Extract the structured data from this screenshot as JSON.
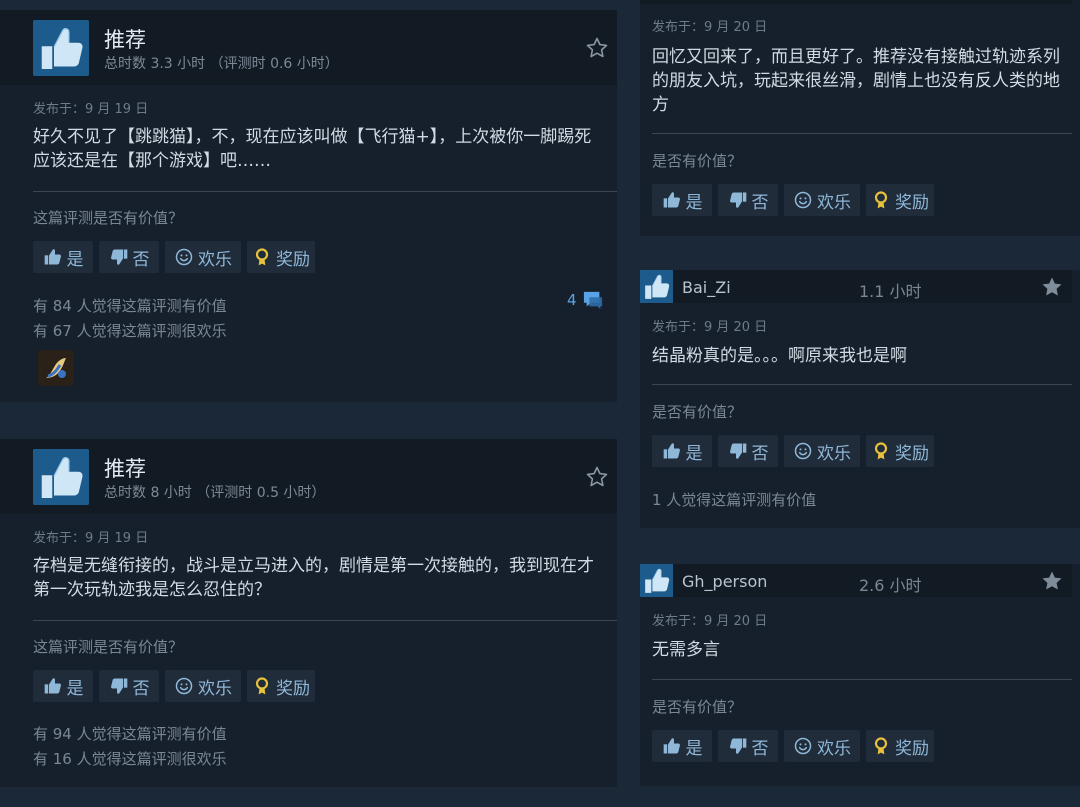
{
  "colors": {
    "background": "#1b2838",
    "panel": "#16202d",
    "header": "#121a24",
    "link": "#8fb8d8",
    "accent_blue": "#5aa3e6",
    "award_gold": "#e8c23a"
  },
  "icons": [
    "thumbs-up-icon",
    "thumbs-down-icon",
    "smile-icon",
    "award-ribbon-icon",
    "star-icon",
    "comment-icon"
  ],
  "left_reviews": [
    {
      "recommendation": "推荐",
      "playtime": "总时数 3.3 小时 （评测时 0.6 小时）",
      "date": "发布于：9 月 19 日",
      "text": "好久不见了【跳跳猫】，不，现在应该叫做【飞行猫+】，上次被你一脚踢死应该还是在【那个游戏】吧……",
      "question": "这篇评测是否有价值？",
      "buttons": {
        "yes": "是",
        "no": "否",
        "funny": "欢乐",
        "award": "奖励"
      },
      "helpful_text": "有 84 人觉得这篇评测有价值",
      "funny_text": "有 67 人觉得这篇评测很欢乐",
      "comment_count": "4"
    },
    {
      "recommendation": "推荐",
      "playtime": "总时数 8 小时 （评测时 0.5 小时）",
      "date": "发布于：9 月 19 日",
      "text": "存档是无缝衔接的，战斗是立马进入的，剧情是第一次接触的，我到现在才第一次玩轨迹我是怎么忍住的？",
      "question": "这篇评测是否有价值？",
      "buttons": {
        "yes": "是",
        "no": "否",
        "funny": "欢乐",
        "award": "奖励"
      },
      "helpful_text": "有 94 人觉得这篇评测有价值",
      "funny_text": "有 16 人觉得这篇评测很欢乐"
    }
  ],
  "right_reviews": [
    {
      "date": "发布于：9 月 20 日",
      "text": "回忆又回来了，而且更好了。推荐没有接触过轨迹系列的朋友入坑，玩起来很丝滑，剧情上也没有反人类的地方",
      "question": "是否有价值？",
      "buttons": {
        "yes": "是",
        "no": "否",
        "funny": "欢乐",
        "award": "奖励"
      }
    },
    {
      "username": "Bai_Zi",
      "hours": "1.1 小时",
      "date": "发布于：9 月 20 日",
      "text": "结晶粉真的是。。。啊原来我也是啊",
      "question": "是否有价值？",
      "buttons": {
        "yes": "是",
        "no": "否",
        "funny": "欢乐",
        "award": "奖励"
      },
      "helpful_text": "1 人觉得这篇评测有价值"
    },
    {
      "username": "Gh_person",
      "hours": "2.6 小时",
      "date": "发布于：9 月 20 日",
      "text": "无需多言",
      "question": "是否有价值？",
      "buttons": {
        "yes": "是",
        "no": "否",
        "funny": "欢乐",
        "award": "奖励"
      }
    }
  ]
}
